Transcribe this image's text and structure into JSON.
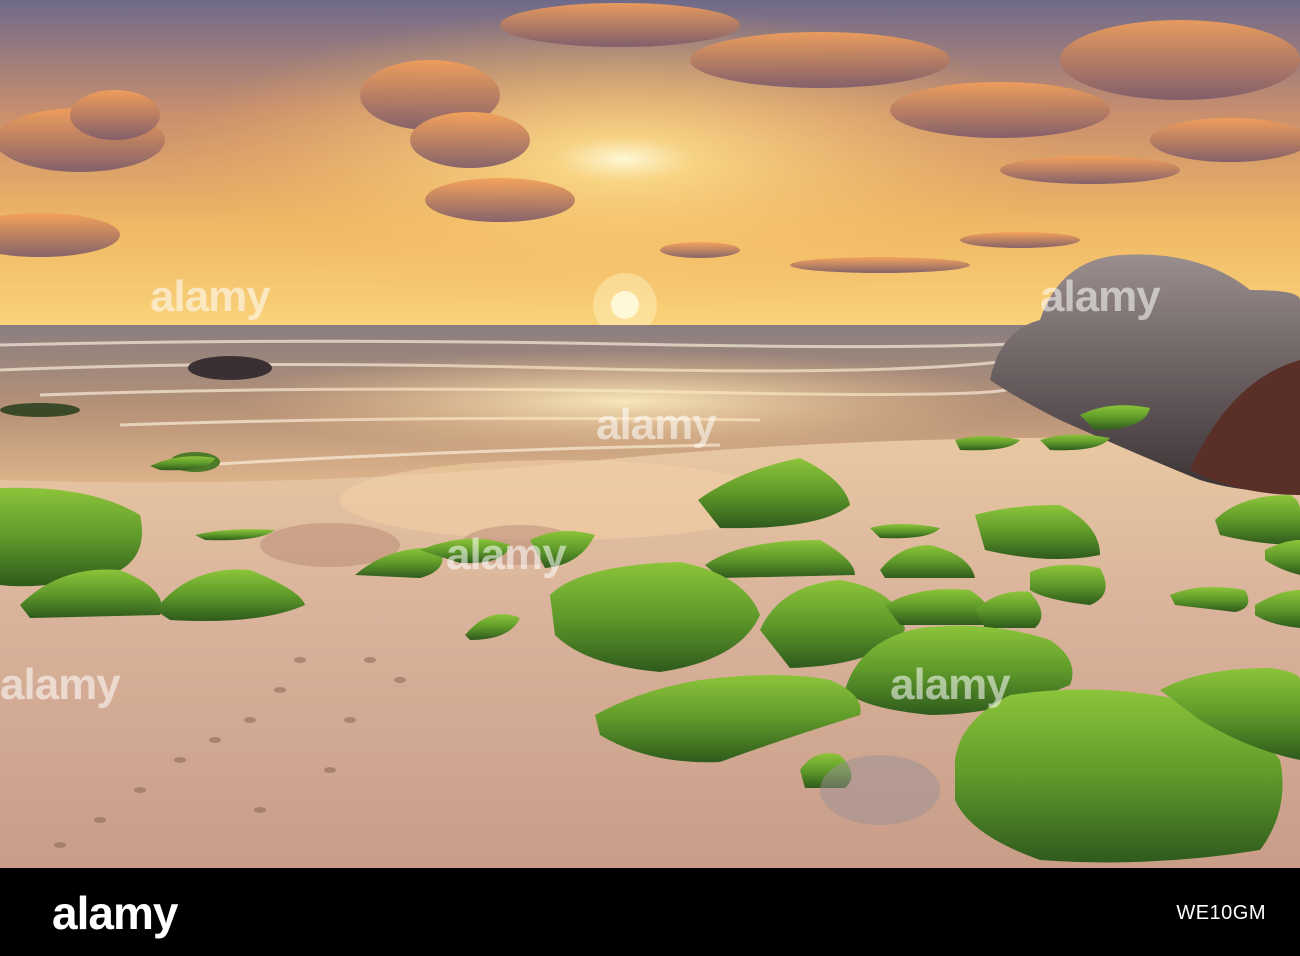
{
  "image": {
    "subject": "sunset-over-sea-with-moss-covered-rocks-on-sandy-beach",
    "palette": {
      "sky_top": "#6f6a8a",
      "sky_mid": "#e9a55a",
      "sky_horizon": "#f7c86a",
      "sun": "#fff4c2",
      "sea": "#6f6f78",
      "sand": "#d8b39a",
      "moss": "#5e9a2a",
      "rock": "#3a3536"
    }
  },
  "watermark": {
    "text": "alamy"
  },
  "footer": {
    "logo_text": "alamy",
    "image_id": "WE10GM"
  }
}
